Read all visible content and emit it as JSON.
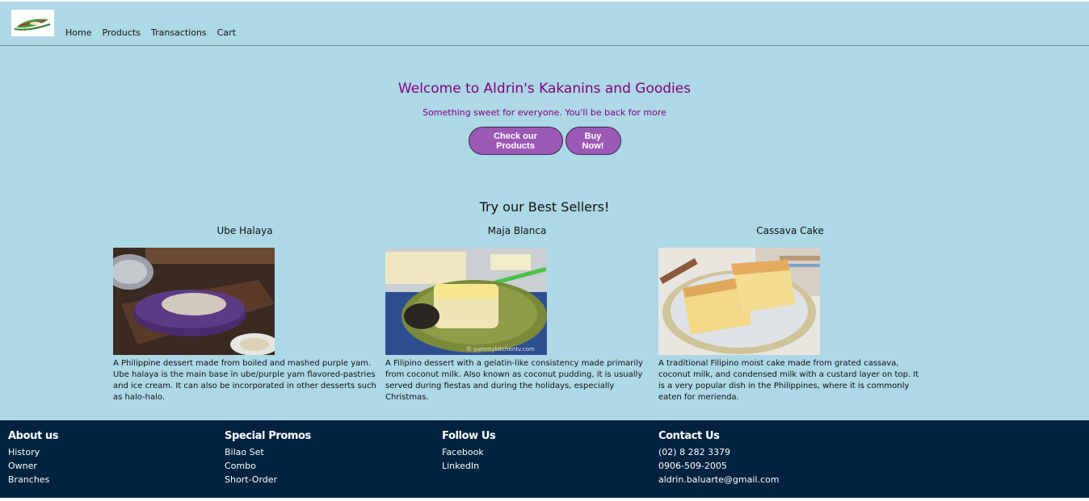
{
  "nav": {
    "logo_alt": "Aldrin's Kakanins and Goodies logo",
    "links": [
      "Home",
      "Products",
      "Transactions",
      "Cart"
    ]
  },
  "hero": {
    "title": "Welcome to Aldrin's Kakanins and Goodies",
    "subtitle": "Something sweet for everyone. You'll be back for more",
    "check_button": "Check our Products",
    "buy_button": "Buy Now!"
  },
  "best_sellers": {
    "title": "Try our Best Sellers!",
    "items": [
      {
        "name": "Ube Halaya",
        "description": "A Philippine dessert made from boiled and mashed purple yam. Ube halaya is the main base in ube/purple yam flavored-pastries and ice cream. It can also be incorporated in other desserts such as halo-halo."
      },
      {
        "name": "Maja Blanca",
        "description": "A Filipino dessert with a gelatin-like consistency made primarily from coconut milk. Also known as coconut pudding, it is usually served during fiestas and during the holidays, especially Christmas."
      },
      {
        "name": "Cassava Cake",
        "description": "A traditional Filipino moist cake made from grated cassava, coconut milk, and condensed milk with a custard layer on top. It is a very popular dish in the Philippines, where it is commonly eaten for merienda."
      }
    ]
  },
  "footer": {
    "about": {
      "heading": "About us",
      "links": [
        "History",
        "Owner",
        "Branches"
      ]
    },
    "promos": {
      "heading": "Special Promos",
      "links": [
        "Bilao Set",
        "Combo",
        "Short-Order"
      ]
    },
    "follow": {
      "heading": "Follow Us",
      "links": [
        "Facebook",
        "LinkedIn"
      ]
    },
    "contact": {
      "heading": "Contact Us",
      "lines": [
        "(02) 8 282 3379",
        "0906-509-2005",
        "aldrin.baluarte@gmail.com"
      ]
    }
  },
  "colors": {
    "background": "#add8e6",
    "accent_purple": "#800080",
    "button_purple": "#9b59b6",
    "footer_navy": "#012340"
  }
}
